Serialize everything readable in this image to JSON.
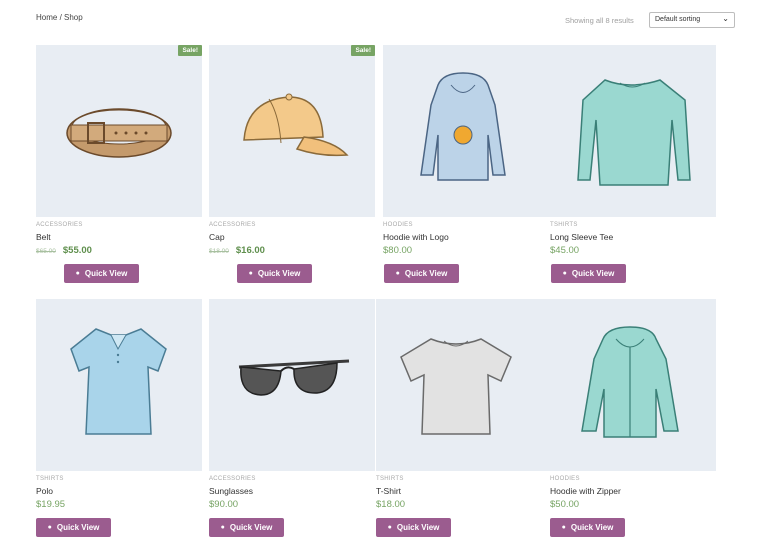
{
  "breadcrumb": "Home / Shop",
  "result_count": "Showing all 8 results",
  "sorting": {
    "selected": "Default sorting"
  },
  "quick_view_label": "Quick View",
  "colors": {
    "accent": "#9b5c8f",
    "price": "#77a464",
    "sale_badge": "#77a464",
    "image_bg": "#e8edf3"
  },
  "products": [
    {
      "category": "ACCESSORIES",
      "name": "Belt",
      "old_price": "$65.00",
      "price": "$55.00",
      "sale": "Sale!",
      "icon": "belt-icon"
    },
    {
      "category": "ACCESSORIES",
      "name": "Cap",
      "old_price": "$18.00",
      "price": "$16.00",
      "sale": "Sale!",
      "icon": "cap-icon"
    },
    {
      "category": "HOODIES",
      "name": "Hoodie with Logo",
      "price": "$80.00",
      "icon": "hoodie-logo-icon"
    },
    {
      "category": "TSHIRTS",
      "name": "Long Sleeve Tee",
      "price": "$45.00",
      "icon": "long-sleeve-tee-icon"
    },
    {
      "category": "TSHIRTS",
      "name": "Polo",
      "price": "$19.95",
      "icon": "polo-icon"
    },
    {
      "category": "ACCESSORIES",
      "name": "Sunglasses",
      "price": "$90.00",
      "icon": "sunglasses-icon"
    },
    {
      "category": "TSHIRTS",
      "name": "T-Shirt",
      "price": "$18.00",
      "icon": "tshirt-icon"
    },
    {
      "category": "HOODIES",
      "name": "Hoodie with Zipper",
      "price": "$50.00",
      "icon": "hoodie-zipper-icon"
    }
  ]
}
